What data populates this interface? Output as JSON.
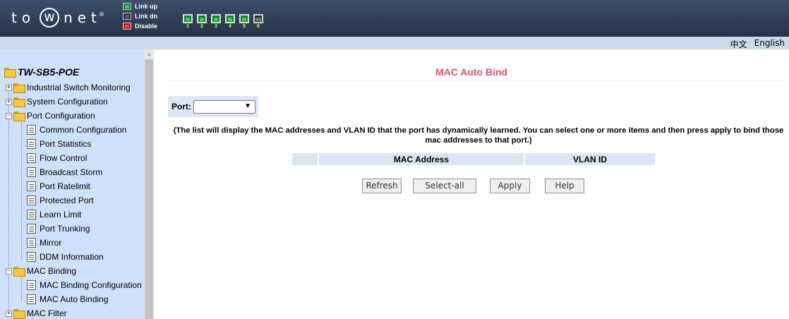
{
  "header": {
    "logo_text": "towmet",
    "logo_parts": {
      "pre": "to",
      "ring": "w",
      "post": "net",
      "reg": "®"
    },
    "legend": [
      {
        "label": "Link up",
        "status": "up"
      },
      {
        "label": "Link dn",
        "status": "down"
      },
      {
        "label": "Disable",
        "status": "disabled"
      }
    ],
    "ports": [
      {
        "num": "1",
        "status": "up"
      },
      {
        "num": "2",
        "status": "up"
      },
      {
        "num": "3",
        "status": "up"
      },
      {
        "num": "4",
        "status": "up"
      },
      {
        "num": "5",
        "status": "up"
      },
      {
        "num": "6",
        "status": "sfp"
      }
    ],
    "colors": {
      "bar": "#2c3a52",
      "link_up": "#2fd24a",
      "disable": "#ff3b3b",
      "port_num": "#f4e36a"
    }
  },
  "language": {
    "chinese": "中文",
    "english": "English"
  },
  "sidebar": {
    "root": "TW-SB5-POE",
    "items": [
      {
        "label": "Industrial Switch Monitoring",
        "type": "folder",
        "expander": "+"
      },
      {
        "label": "System Configuration",
        "type": "folder",
        "expander": "+"
      },
      {
        "label": "Port Configuration",
        "type": "folder",
        "expander": "−"
      },
      {
        "label": "Common Configuration",
        "type": "page"
      },
      {
        "label": "Port Statistics",
        "type": "page"
      },
      {
        "label": "Flow Control",
        "type": "page"
      },
      {
        "label": "Broadcast Storm",
        "type": "page"
      },
      {
        "label": "Port Ratelimit",
        "type": "page"
      },
      {
        "label": "Protected Port",
        "type": "page"
      },
      {
        "label": "Learn Limit",
        "type": "page"
      },
      {
        "label": "Port Trunking",
        "type": "page"
      },
      {
        "label": "Mirror",
        "type": "page"
      },
      {
        "label": "DDM Information",
        "type": "page"
      },
      {
        "label": "MAC Binding",
        "type": "folder",
        "expander": "−"
      },
      {
        "label": "MAC Binding Configuration",
        "type": "page"
      },
      {
        "label": "MAC Auto Binding",
        "type": "page"
      },
      {
        "label": "MAC Filter",
        "type": "folder",
        "expander": "+"
      }
    ],
    "background": "#cfe0fb"
  },
  "main": {
    "title": "MAC Auto Bind",
    "title_color": "#e0506a",
    "port_label": "Port:",
    "port_value": "",
    "info": "(The list will display the MAC addresses and VLAN ID that the port has dynamically learned. You can select one or more items and then press apply to bind those mac addresses to that port.)",
    "table": {
      "headers": [
        "",
        "MAC Address",
        "VLAN ID"
      ],
      "rows": []
    },
    "buttons": {
      "refresh": "Refresh",
      "select_all": "Select-all",
      "apply": "Apply",
      "help": "Help"
    }
  }
}
